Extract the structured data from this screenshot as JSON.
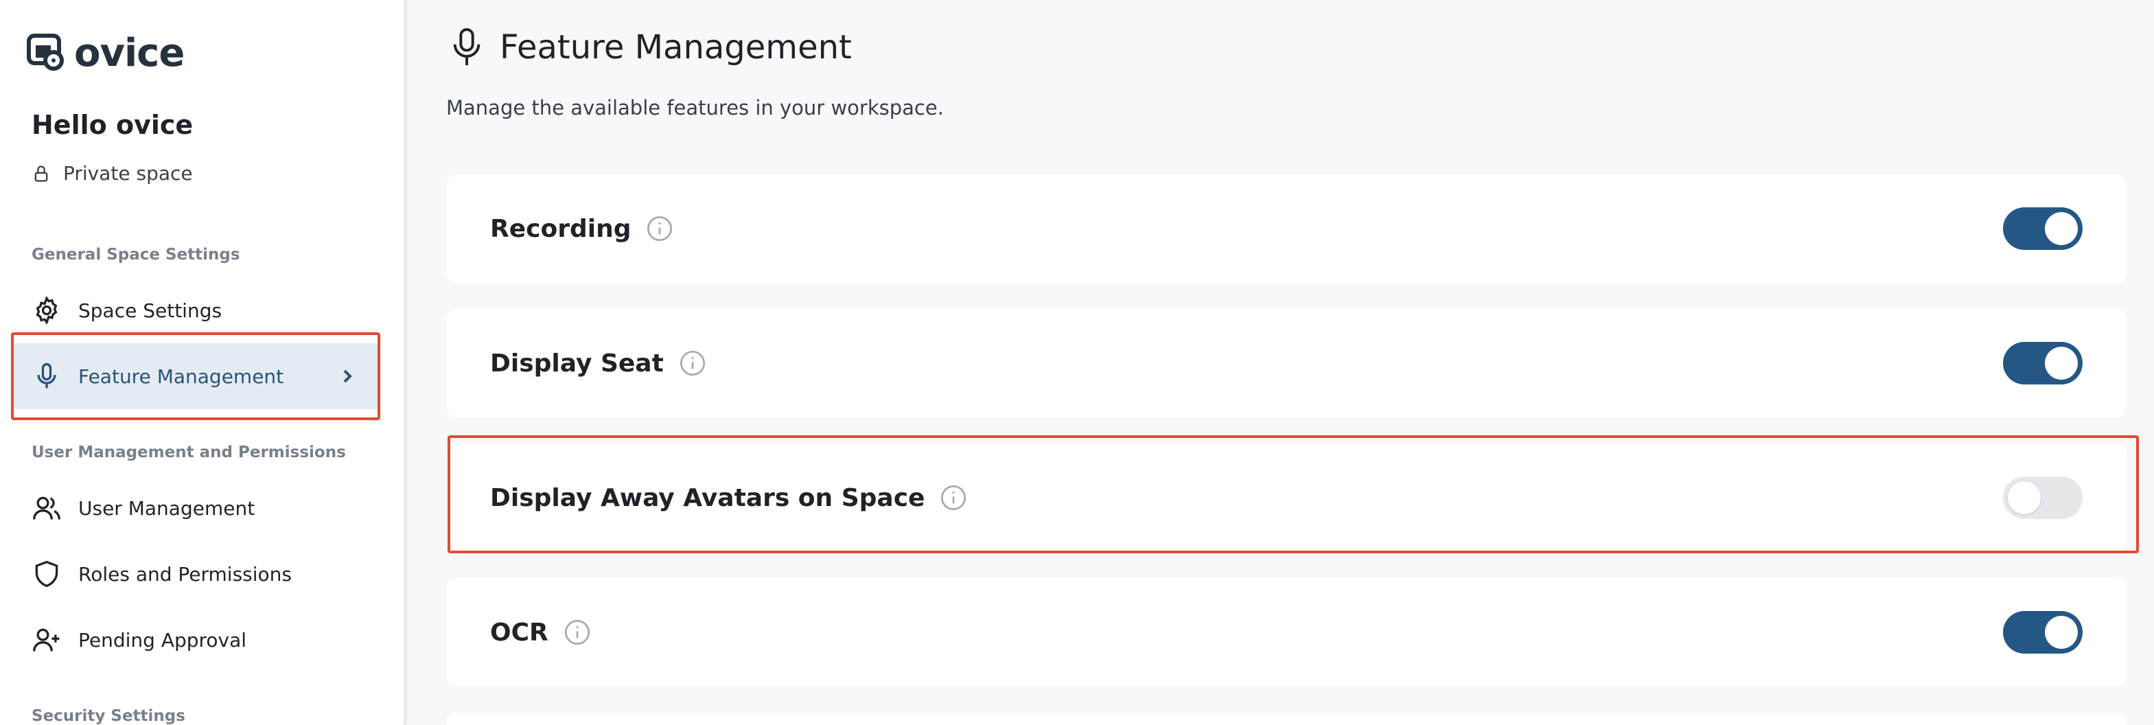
{
  "brand": {
    "name": "ovice"
  },
  "sidebar": {
    "greeting": "Hello ovice",
    "space_type": "Private space",
    "sections": [
      {
        "label": "General Space Settings"
      },
      {
        "label": "User Management and Permissions"
      },
      {
        "label": "Security Settings"
      }
    ],
    "items": [
      {
        "label": "Space Settings",
        "icon": "gear-icon"
      },
      {
        "label": "Feature Management",
        "icon": "microphone-icon",
        "active": true
      },
      {
        "label": "User Management",
        "icon": "users-icon"
      },
      {
        "label": "Roles and Permissions",
        "icon": "shield-icon"
      },
      {
        "label": "Pending Approval",
        "icon": "user-plus-icon"
      }
    ]
  },
  "main": {
    "title": "Feature Management",
    "subtitle": "Manage the available features in your workspace.",
    "features": [
      {
        "label": "Recording",
        "enabled": true
      },
      {
        "label": "Display Seat",
        "enabled": true
      },
      {
        "label": "Display Away Avatars on Space",
        "enabled": false
      },
      {
        "label": "OCR",
        "enabled": true
      }
    ]
  },
  "colors": {
    "accent": "#255784",
    "active_bg": "#e4ebf3",
    "highlight": "#e04a36",
    "toggle_off": "#e8e6ea"
  }
}
